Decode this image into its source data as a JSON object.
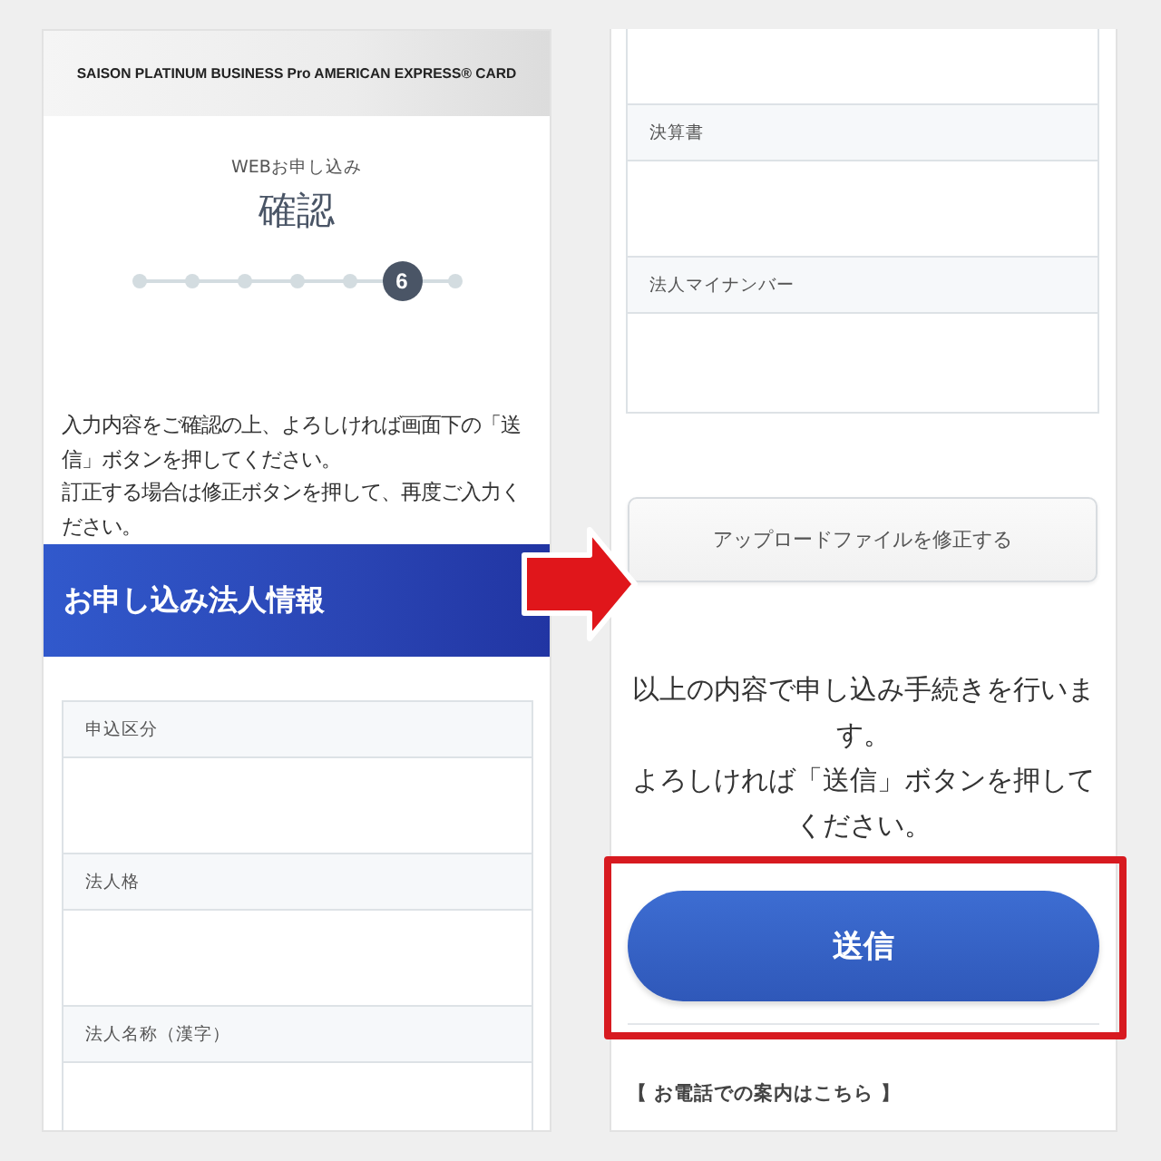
{
  "left_panel": {
    "brand": "SAISON PLATINUM BUSINESS Pro AMERICAN EXPRESS® CARD",
    "subtitle": "WEBお申し込み",
    "title": "確認",
    "steps": [
      {
        "selected": false
      },
      {
        "selected": false
      },
      {
        "selected": false
      },
      {
        "selected": false
      },
      {
        "selected": false
      },
      {
        "label": "6",
        "selected": true
      },
      {
        "selected": false
      }
    ],
    "intro": [
      "入力内容をご確認の上、よろしければ画面下の「送信」ボタンを押してください。",
      "訂正する場合は修正ボタンを押して、再度ご入力ください。"
    ],
    "section_title": "お申し込み法人情報",
    "fields": [
      {
        "label": "申込区分"
      },
      {
        "label": "法人格"
      },
      {
        "label": "法人名称（漢字）"
      }
    ]
  },
  "right_panel": {
    "fields": [
      {
        "label": "決算書"
      },
      {
        "label": "法人マイナンバー"
      }
    ],
    "edit_button": "アップロードファイルを修正する",
    "notice": [
      "以上の内容で申し込み手続きを行います。",
      "よろしければ「送信」ボタンを押してください。"
    ],
    "submit_button": "送信",
    "phone_heading": "【 お電話での案内はこちら 】"
  }
}
